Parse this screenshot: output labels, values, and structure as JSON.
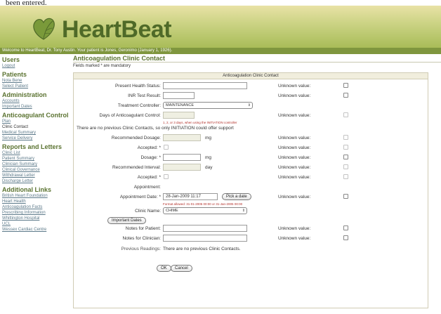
{
  "cut_text": "been entered.",
  "app": {
    "logo_text": "HeartBeat"
  },
  "welcome_text": "Welcome to HeartBeat, Dr. Tony Austin. Your patient is Jones, Geronimo (January 1, 1926).",
  "sidebar": {
    "users": {
      "title": "Users",
      "items": [
        "Logout"
      ]
    },
    "patients": {
      "title": "Patients",
      "items": [
        "Nota Bene",
        "Select Patient"
      ]
    },
    "administration": {
      "title": "Administration",
      "items": [
        "Accounts",
        "Important Dates"
      ]
    },
    "anticoagulant": {
      "title": "Anticoagulant Control",
      "items": [
        "Plan",
        "Clinic Contact",
        "Medical Summary",
        "Service Delivery"
      ]
    },
    "reports": {
      "title": "Reports and Letters",
      "items": [
        "Clinic List",
        "Patient Summary",
        "Clinician Summary",
        "Clinical Governance",
        "Withdrawal Letter",
        "Discharge Letter"
      ]
    },
    "links": {
      "title": "Additional Links",
      "items": [
        "British Heart Foundation",
        "Heart Health",
        "Anticoagulation Facts",
        "Prescribing Information",
        "Whittington Hospital",
        "UCL",
        "Wessex Cardiac Centre"
      ]
    }
  },
  "main": {
    "title": "Anticoagulation Clinic Contact",
    "mandatory_note": "Fields marked * are mandatory",
    "form_header": "Anticoagulation Clinic Contact",
    "unknown_label": "Unknown value:",
    "fields": {
      "present_health": "Present Health Status:",
      "inr": "INR Test Result:",
      "treatment_controller": "Treatment Controller:",
      "treatment_controller_value": "MAINTENANCE",
      "days_control": "Days of Anticoagulant Control:",
      "days_hint": "1, 2, or 3 days, when using the INITIATION controller",
      "no_previous_note": "There are no previous Clinic Contacts, so only INITIATION could offer support",
      "recommended_dosage": "Recommended Dosage:",
      "recommended_dosage_unit": "mg",
      "accepted_1": "Accepted: *",
      "dosage": "Dosage: *",
      "dosage_unit": "mg",
      "recommended_interval": "Recommended Interval:",
      "recommended_interval_unit": "day",
      "accepted_2": "Accepted: *",
      "appointment": "Appointment:",
      "appointment_date": "Appointment Date: *",
      "appointment_date_value": "28-Jan-2009 11:17",
      "pick_date_button": "Pick a date",
      "date_hint": "Format allowed: 31-01-2005 00:00 or 31-Jan-2005 00:00",
      "clinic_name": "Clinic Name:",
      "clinic_name_value": "CHIME",
      "important_dates_button": "Important Dates",
      "notes_patient": "Notes for Patient:",
      "notes_clinician": "Notes for Clinician:",
      "previous_readings": "Previous Readings:",
      "previous_readings_value": "There are no previous Clinic Contacts."
    },
    "ok_button": "OK",
    "cancel_button": "Cancel"
  }
}
